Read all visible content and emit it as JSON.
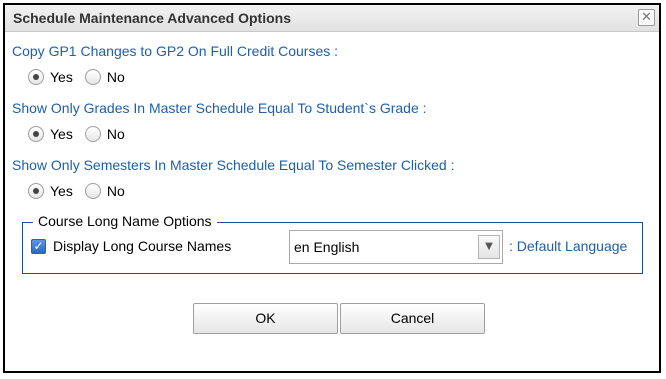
{
  "dialog": {
    "title": "Schedule Maintenance Advanced Options",
    "close_icon": "close-icon"
  },
  "questions": [
    {
      "label": "Copy GP1 Changes to GP2 On Full Credit Courses :",
      "selected": "Yes",
      "options": [
        "Yes",
        "No"
      ]
    },
    {
      "label": "Show Only Grades In Master Schedule Equal To Student`s Grade :",
      "selected": "Yes",
      "options": [
        "Yes",
        "No"
      ]
    },
    {
      "label": "Show Only Semesters In Master Schedule Equal To Semester Clicked :",
      "selected": "Yes",
      "options": [
        "Yes",
        "No"
      ]
    }
  ],
  "course_long_name": {
    "legend": "Course Long Name Options",
    "checkbox_label": "Display Long Course Names",
    "checkbox_checked": true,
    "language_value": "en English",
    "default_language_label": ": Default Language"
  },
  "buttons": {
    "ok": "OK",
    "cancel": "Cancel"
  },
  "colors": {
    "question_text": "#1f5fa8",
    "fieldset_border": "#1f4e96",
    "checkbox_fill": "#2d67c6"
  }
}
